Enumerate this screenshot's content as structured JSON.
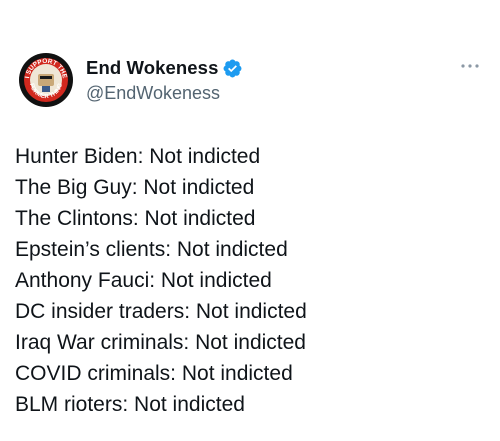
{
  "tweet": {
    "author": {
      "display_name": "End Wokeness",
      "handle": "@EndWokeness",
      "verified": true,
      "avatar_icon": "avatar-logo-icon",
      "avatar_badge_text_top": "I SUPPORT THE",
      "avatar_badge_text_bottom": "FORMER THING"
    },
    "more_icon": "more-options-icon",
    "lines": [
      "Hunter Biden: Not indicted",
      "The Big Guy: Not indicted",
      "The Clintons: Not indicted",
      "Epstein’s clients: Not indicted",
      "Anthony Fauci: Not indicted",
      "DC insider traders: Not indicted",
      "Iraq War criminals: Not indicted",
      "COVID criminals: Not indicted",
      "BLM rioters: Not indicted"
    ],
    "colors": {
      "text": "#0f1419",
      "secondary": "#536471",
      "verified": "#1d9bf0",
      "avatar_red": "#d1281e"
    }
  }
}
